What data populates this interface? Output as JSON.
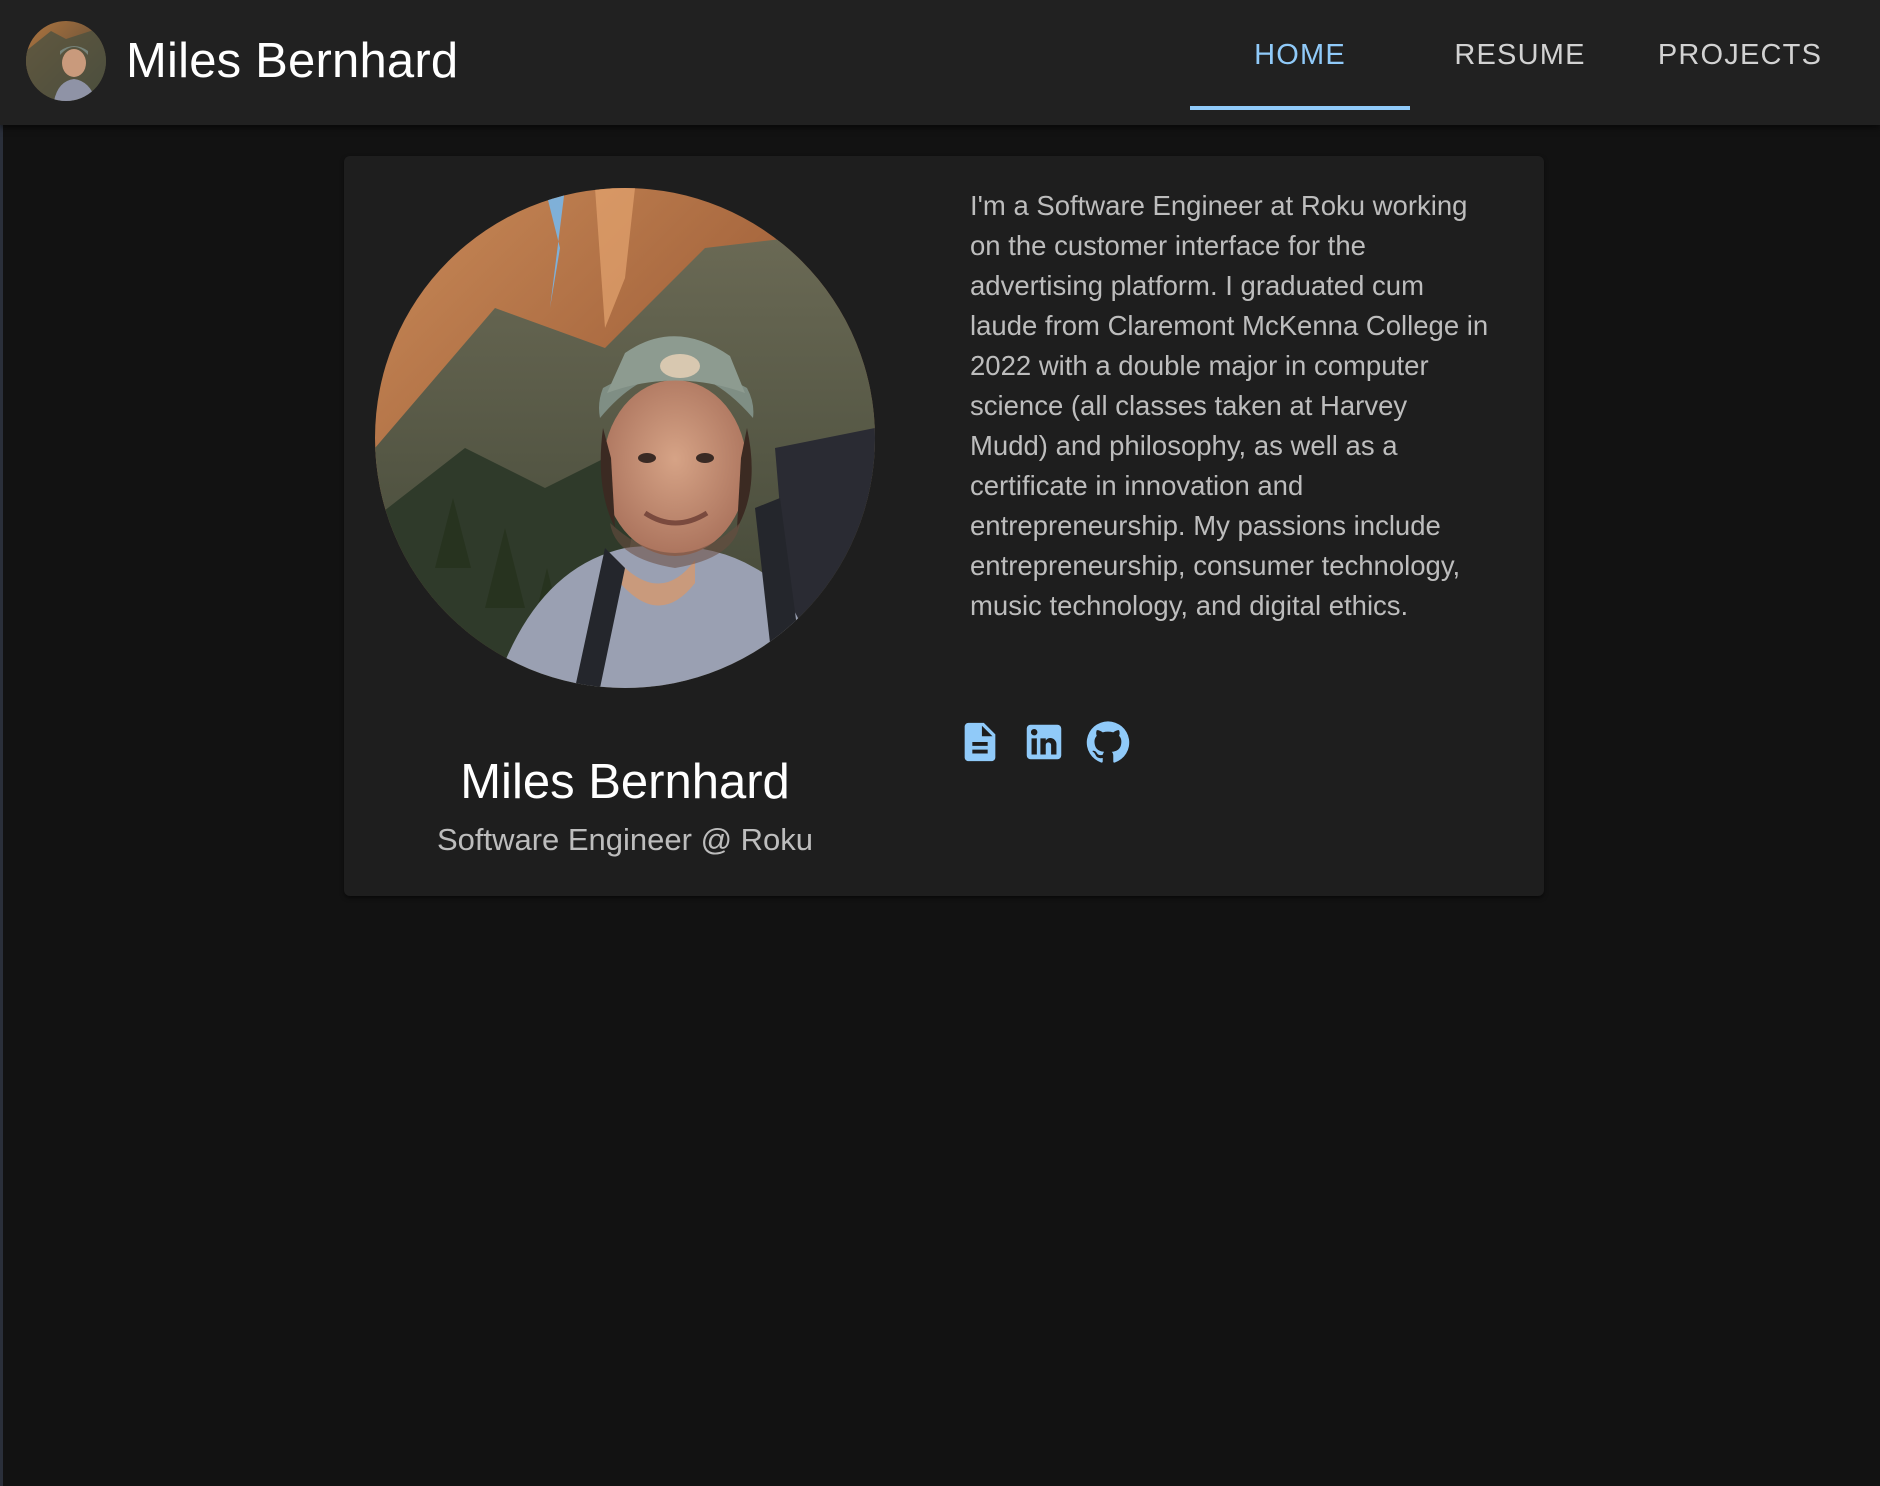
{
  "app": {
    "title": "Miles Bernhard"
  },
  "nav": {
    "tabs": [
      {
        "label": "HOME",
        "active": true
      },
      {
        "label": "RESUME",
        "active": false
      },
      {
        "label": "PROJECTS",
        "active": false
      }
    ]
  },
  "profile": {
    "name": "Miles Bernhard",
    "role": "Software Engineer @ Roku",
    "bio": "I'm a Software Engineer at Roku working on the customer interface for the advertising platform. I graduated cum laude from Claremont McKenna College in 2022 with a double major in computer science (all classes taken at Harvey Mudd) and philosophy, as well as a certificate in innovation and entrepreneurship. My passions include entrepreneurship, consumer technology, music technology, and digital ethics."
  },
  "links": [
    {
      "icon": "document-icon"
    },
    {
      "icon": "linkedin-icon"
    },
    {
      "icon": "github-icon"
    }
  ],
  "colors": {
    "background": "#121212",
    "appbar": "#212121",
    "card": "#1e1e1e",
    "accent": "#90caf9",
    "text_primary": "#ffffff",
    "text_secondary": "#bdbdbd"
  }
}
